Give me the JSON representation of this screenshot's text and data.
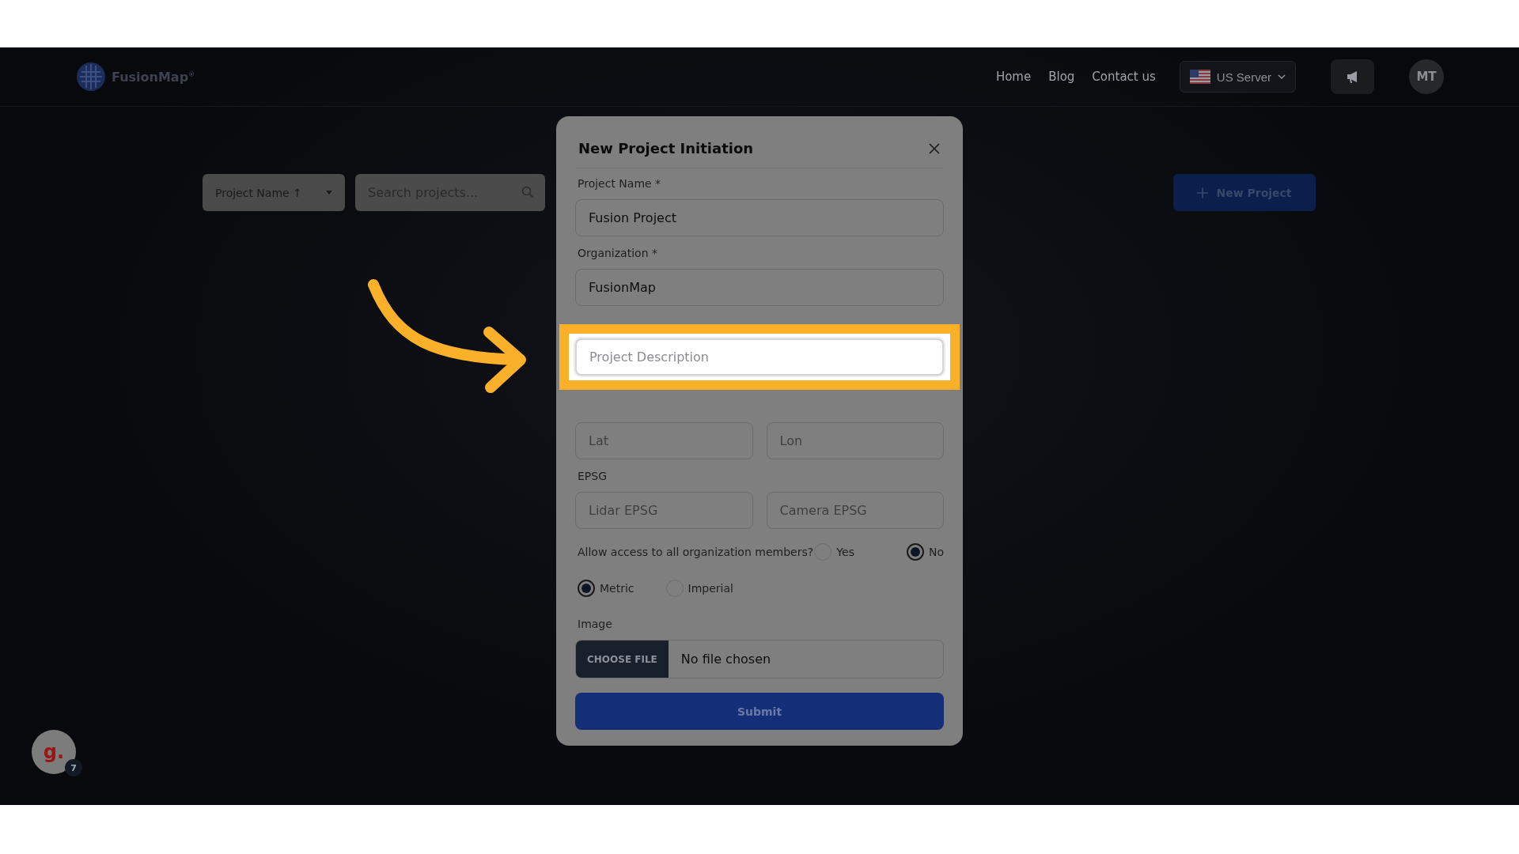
{
  "header": {
    "logo": "FusionMap$^{®}$",
    "nav": [
      {
        "label": "Home"
      },
      {
        "label": "Blog"
      },
      {
        "label": "Contact us"
      }
    ],
    "server": "US Server",
    "avatar": "MT"
  },
  "toolbar": {
    "sort": "Project Name ↑",
    "search_placeholder": "Search projects...",
    "new_button": "New Project"
  },
  "modal": {
    "title": "New Project Initiation",
    "form": [
      {
        "kind": "text",
        "label": "Project Name *",
        "value": "Fusion Project",
        "highlighted": false
      },
      {
        "kind": "text",
        "label": "Organization *",
        "value": "FusionMap",
        "highlighted": false
      },
      {
        "kind": "text",
        "placeholder": "Project Description",
        "highlighted": true
      },
      {
        "kind": "pair",
        "inputs": [
          {
            "placeholder": "Lat"
          },
          {
            "placeholder": "Lon"
          }
        ]
      },
      {
        "kind": "pair",
        "label": "EPSG",
        "inputs": [
          {
            "placeholder": "Lidar EPSG"
          },
          {
            "placeholder": "Camera EPSG"
          }
        ]
      },
      {
        "kind": "radio",
        "label": "Allow access to all organization members?",
        "options": [
          {
            "label": "Yes",
            "selected": false
          },
          {
            "label": "No",
            "selected": true
          }
        ]
      },
      {
        "kind": "radio",
        "options": [
          {
            "label": "Metric",
            "selected": true
          },
          {
            "label": "Imperial",
            "selected": false
          }
        ]
      },
      {
        "kind": "file",
        "label": "Image",
        "button": "CHOOSE FILE",
        "status": "No file chosen"
      }
    ],
    "submit": "Submit"
  },
  "help_widget": {
    "letter": "g.",
    "count": "7"
  }
}
